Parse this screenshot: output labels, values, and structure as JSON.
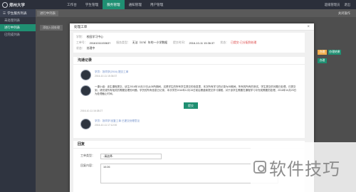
{
  "app": {
    "logo_text": "郑州大学"
  },
  "topnav": {
    "items": [
      "工作台",
      "学生管理",
      "服务管理",
      "通知管理",
      "用户管理"
    ],
    "active_index": 2
  },
  "topright": {
    "user": "超级管理员",
    "logout": "退出"
  },
  "sidebar": {
    "group_label": "学生服务列表",
    "items": [
      "未处理列表",
      "进行中列表",
      "已完成列表"
    ],
    "active_index": 1
  },
  "tabs": {
    "current": "进行中列表",
    "breadcrumb": "添加入班处理",
    "right_action": "关闭操作"
  },
  "colors": {
    "accent": "#1f8f72",
    "danger": "#d93a3a",
    "warning": "#f0ad4e"
  },
  "background_buttons": {
    "orange": "办理",
    "green": "办理结果"
  },
  "modal": {
    "title": "处理工单",
    "info": {
      "row1_label": "学院：",
      "row1_value": "校园学习中心",
      "row2_label": "工单号：",
      "row2_value": "2016101115363?",
      "row2_type_label": "服务类型：",
      "row2_type_value": "无法（578）年的一小学数据",
      "row2_time_label": "提交时间：",
      "row2_time_value": "2016-10-11 15:36:37",
      "row2_status_label": "状态：",
      "row2_status_value": "已提交·已分配到处理",
      "row3_label": "状态：",
      "row3_value": "处理中"
    },
    "records": {
      "title": "沟通记录",
      "items": [
        {
          "name": "学员：张同学(2016) 提交工单",
          "time": "2016-10-11 15:36:37"
        },
        {
          "name": "",
          "time": "",
          "text": "一课小组：该生课程提交，该生2016年10月22日从05所期间，这是学生的所有学生提交的信息里，本次所有学习的记录为05期间，所有的所有的测试，学生提交的问题已处理，已提交到，请完成所有相关的需要处理的问题。学员的所有信息已记录，本次学员2016年12月15日前后需重新提交学习课程，对于该学生需要在课程学习中完成需要的处理，2016年10月29日为处理截止时间。",
          "time2": "2016-10-11 16:38:27"
        },
        {
          "name": "学员：张同学 回复工单 已提交处理意见",
          "time": "2016-10-11 17:12:00"
        }
      ]
    },
    "reply": {
      "title": "回复",
      "type_label": "工单类型：",
      "type_value": "-请选择-",
      "content_label": "回复内容：",
      "content_value": "10:26",
      "submit_label": "提交"
    }
  },
  "watermark": {
    "text": "软件技巧"
  }
}
